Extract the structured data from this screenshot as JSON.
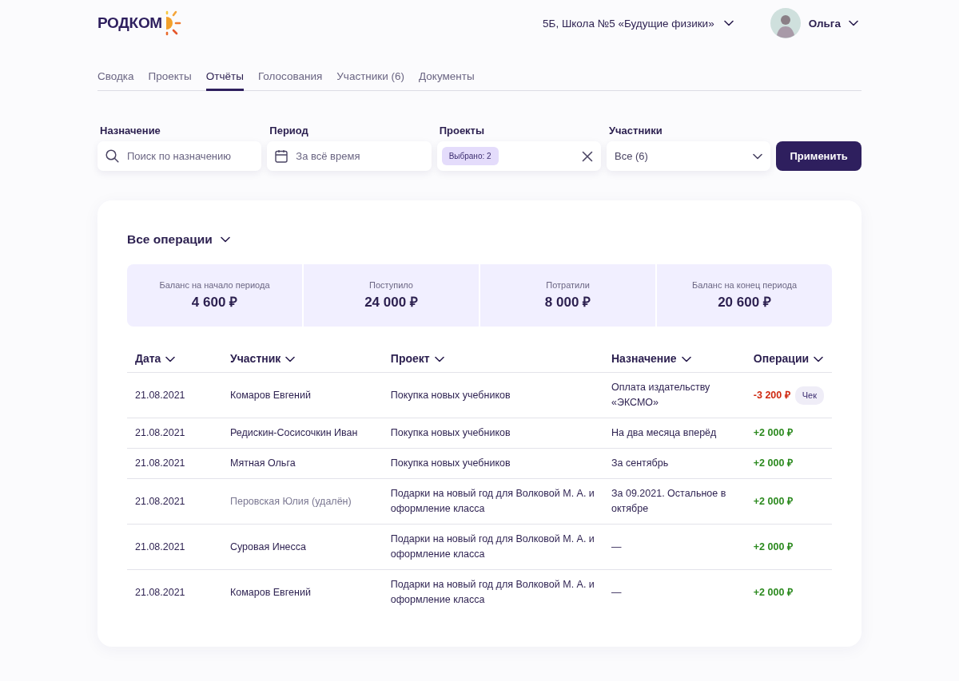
{
  "header": {
    "logo": "РОДКОМ",
    "school": "5Б, Школа №5 «Будущие физики»",
    "user": "Ольга"
  },
  "tabs": [
    {
      "label": "Сводка",
      "selected": false
    },
    {
      "label": "Проекты",
      "selected": false
    },
    {
      "label": "Отчёты",
      "selected": true
    },
    {
      "label": "Голосования",
      "selected": false
    },
    {
      "label": "Участники (6)",
      "selected": false
    },
    {
      "label": "Документы",
      "selected": false
    }
  ],
  "filters": [
    {
      "kind": "search",
      "label": "Назначение",
      "placeholder": "Поиск по назначению"
    },
    {
      "kind": "date",
      "label": "Период",
      "placeholder": "За всё время"
    },
    {
      "kind": "chips",
      "label": "Проекты",
      "chip": "Выбрано: 2"
    },
    {
      "kind": "select",
      "label": "Участники",
      "value": "Все (6)"
    }
  ],
  "apply_button": "Применить",
  "report": {
    "title": "Все операции",
    "stats": [
      {
        "label": "Баланс на начало периода",
        "value": "4 600 ₽"
      },
      {
        "label": "Поступило",
        "value": "24 000 ₽"
      },
      {
        "label": "Потратили",
        "value": "8 000 ₽"
      },
      {
        "label": "Баланс на конец периода",
        "value": "20 600 ₽"
      }
    ],
    "columns": [
      "Дата",
      "Участник",
      "Проект",
      "Назначение",
      "Операции"
    ],
    "rows": [
      {
        "date": "21.08.2021",
        "member": "Комаров Евгений",
        "deleted": false,
        "project": "Покупка новых учебников",
        "purpose": "Оплата издательству «ЭКСМО»",
        "amount": "-3 200 ₽",
        "kind": "expense",
        "receipt": "Чек"
      },
      {
        "date": "21.08.2021",
        "member": "Редискин-Сосисочкин Иван",
        "deleted": false,
        "project": "Покупка новых учебников",
        "purpose": "На два месяца вперёд",
        "amount": "+2 000 ₽",
        "kind": "income"
      },
      {
        "date": "21.08.2021",
        "member": "Мятная Ольга",
        "deleted": false,
        "project": "Покупка новых учебников",
        "purpose": "За сентябрь",
        "amount": "+2 000 ₽",
        "kind": "income"
      },
      {
        "date": "21.08.2021",
        "member": "Перовская Юлия (удалён)",
        "deleted": true,
        "project": "Подарки на новый год для Волковой М. А. и оформление класса",
        "purpose": "За 09.2021. Остальное в октябре",
        "amount": "+2 000 ₽",
        "kind": "income"
      },
      {
        "date": "21.08.2021",
        "member": "Суровая Инесса",
        "deleted": false,
        "project": "Подарки на новый год для Волковой М. А. и оформление класса",
        "purpose": "—",
        "amount": "+2 000 ₽",
        "kind": "income"
      },
      {
        "date": "21.08.2021",
        "member": "Комаров Евгений",
        "deleted": false,
        "project": "Подарки на новый год для Волковой М. А. и оформление класса",
        "purpose": "—",
        "amount": "+2 000 ₽",
        "kind": "income"
      }
    ]
  }
}
